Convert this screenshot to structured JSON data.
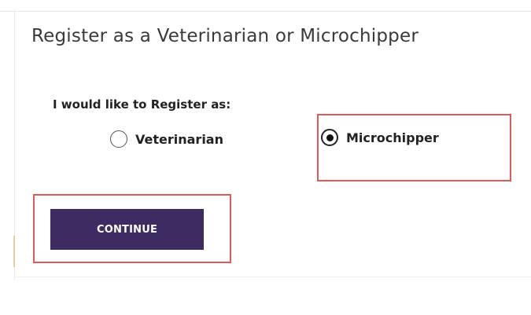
{
  "panel": {
    "title": "Register as a Veterinarian or Microchipper"
  },
  "form": {
    "register_as_label": "I would like to Register as:",
    "options": [
      {
        "label": "Veterinarian",
        "selected": false
      },
      {
        "label": "Microchipper",
        "selected": true
      }
    ],
    "continue_label": "CONTINUE"
  },
  "colors": {
    "button_bg": "#3d2b62",
    "highlight_border": "#e05a5a"
  }
}
